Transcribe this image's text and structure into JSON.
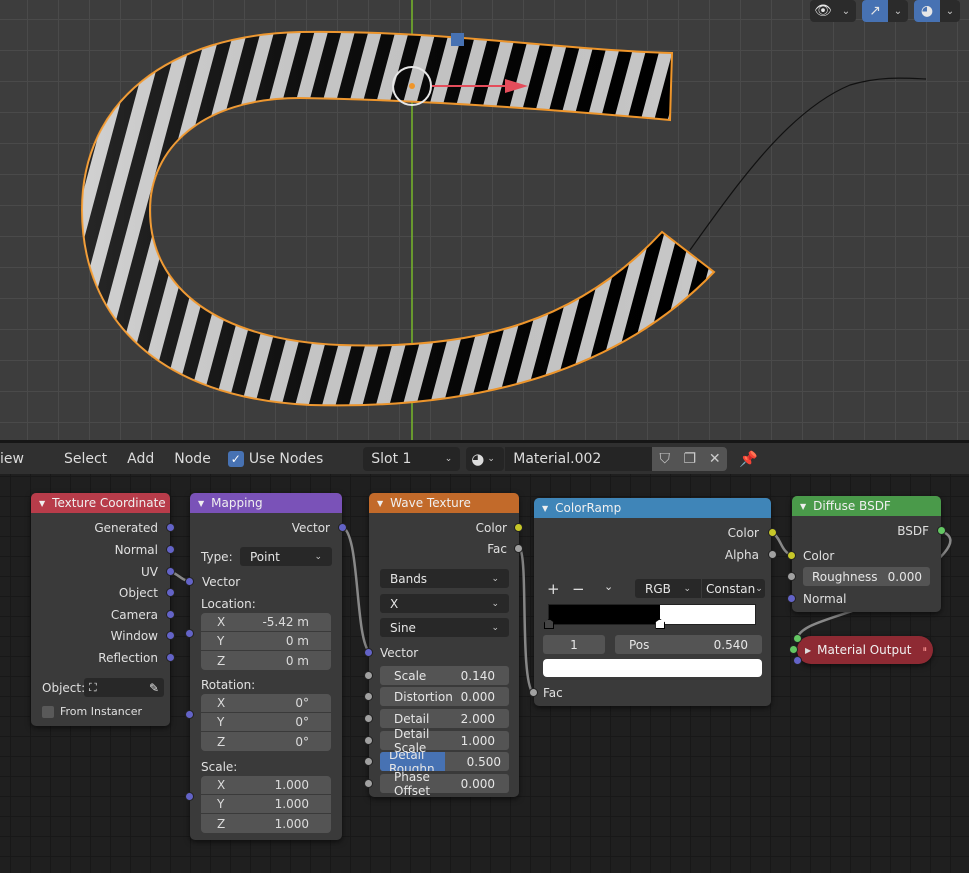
{
  "viewport": {
    "overlay_buttons": [
      {
        "icon": "visibility-eye-icon",
        "active": false
      },
      {
        "icon": "gizmo-icon",
        "active": true
      },
      {
        "icon": "overlays-icon",
        "active": true
      }
    ],
    "colors": {
      "selection_outline": "#f0962a",
      "y_axis": "#76b82a",
      "x_gizmo": "#e44d5b",
      "z_handle": "#4772b3"
    }
  },
  "header": {
    "menus": [
      "iew",
      "Select",
      "Add",
      "Node"
    ],
    "use_nodes_label": "Use Nodes",
    "use_nodes_checked": true,
    "slot": "Slot 1",
    "material_name": "Material.002",
    "icons": [
      "material-sphere-icon",
      "fake-user-shield-icon",
      "duplicate-icon",
      "close-icon",
      "pin-icon"
    ]
  },
  "nodes": {
    "texture_coordinate": {
      "title": "Texture Coordinate",
      "color": "#b83c4a",
      "outputs": [
        "Generated",
        "Normal",
        "UV",
        "Object",
        "Camera",
        "Window",
        "Reflection"
      ],
      "object_label": "Object:",
      "from_instancer_label": "From Instancer",
      "from_instancer_checked": false
    },
    "mapping": {
      "title": "Mapping",
      "color": "#7a52b8",
      "output": "Vector",
      "type_label": "Type:",
      "type_value": "Point",
      "input_vector": "Vector",
      "location_label": "Location:",
      "location": [
        {
          "axis": "X",
          "value": "-5.42 m"
        },
        {
          "axis": "Y",
          "value": "0 m"
        },
        {
          "axis": "Z",
          "value": "0 m"
        }
      ],
      "rotation_label": "Rotation:",
      "rotation": [
        {
          "axis": "X",
          "value": "0°"
        },
        {
          "axis": "Y",
          "value": "0°"
        },
        {
          "axis": "Z",
          "value": "0°"
        }
      ],
      "scale_label": "Scale:",
      "scale": [
        {
          "axis": "X",
          "value": "1.000"
        },
        {
          "axis": "Y",
          "value": "1.000"
        },
        {
          "axis": "Z",
          "value": "1.000"
        }
      ]
    },
    "wave_texture": {
      "title": "Wave Texture",
      "color": "#c26a2a",
      "outputs": [
        "Color",
        "Fac"
      ],
      "wave_type": "Bands",
      "direction": "X",
      "profile": "Sine",
      "input_vector": "Vector",
      "params": [
        {
          "label": "Scale",
          "value": "0.140"
        },
        {
          "label": "Distortion",
          "value": "0.000"
        },
        {
          "label": "Detail",
          "value": "2.000"
        },
        {
          "label": "Detail Scale",
          "value": "1.000"
        },
        {
          "label": "Detail Roughn",
          "value": "0.500",
          "fill": 0.5
        },
        {
          "label": "Phase Offset",
          "value": "0.000"
        }
      ]
    },
    "color_ramp": {
      "title": "ColorRamp",
      "color": "#3f85b8",
      "outputs": [
        "Color",
        "Alpha"
      ],
      "add_label": "+",
      "remove_label": "−",
      "color_mode": "RGB",
      "interpolation": "Constan",
      "stop_index": "1",
      "pos_label": "Pos",
      "pos_value": "0.540",
      "stops": [
        {
          "pos": 0.0,
          "color": "#000000"
        },
        {
          "pos": 0.54,
          "color": "#ffffff"
        }
      ],
      "selected_color": "#ffffff",
      "input": "Fac"
    },
    "diffuse_bsdf": {
      "title": "Diffuse BSDF",
      "color": "#4a9a4a",
      "output": "BSDF",
      "input_color": "Color",
      "roughness_label": "Roughness",
      "roughness_value": "0.000",
      "input_normal": "Normal"
    },
    "material_output": {
      "title": "Material Output",
      "color": "#8e2a33",
      "collapsed": true
    }
  }
}
